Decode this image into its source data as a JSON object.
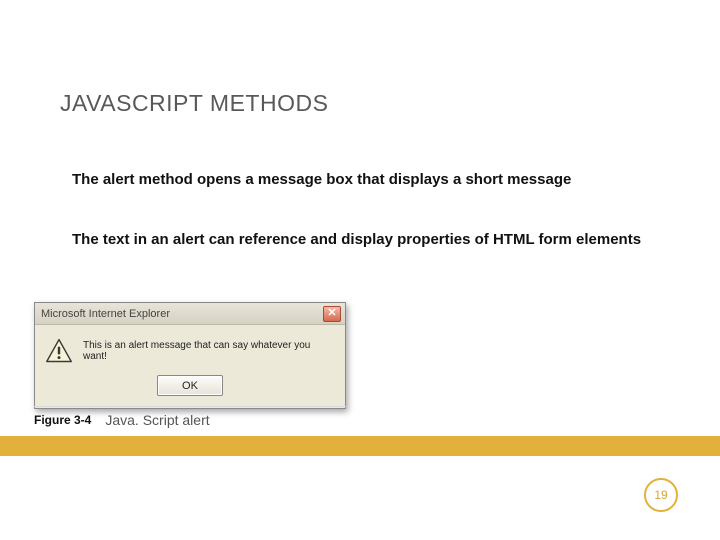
{
  "title": "JAVASCRIPT METHODS",
  "paragraphs": {
    "p1": "The alert method opens a message box that displays a short message",
    "p2": "The text in an alert can reference and display properties of HTML form elements"
  },
  "alert": {
    "window_title": "Microsoft Internet Explorer",
    "close_glyph": "✕",
    "message": "This is an alert message that can say whatever you want!",
    "ok_label": "OK"
  },
  "figure": {
    "number": "Figure 3-4",
    "caption": "Java. Script alert"
  },
  "page_number": "19"
}
